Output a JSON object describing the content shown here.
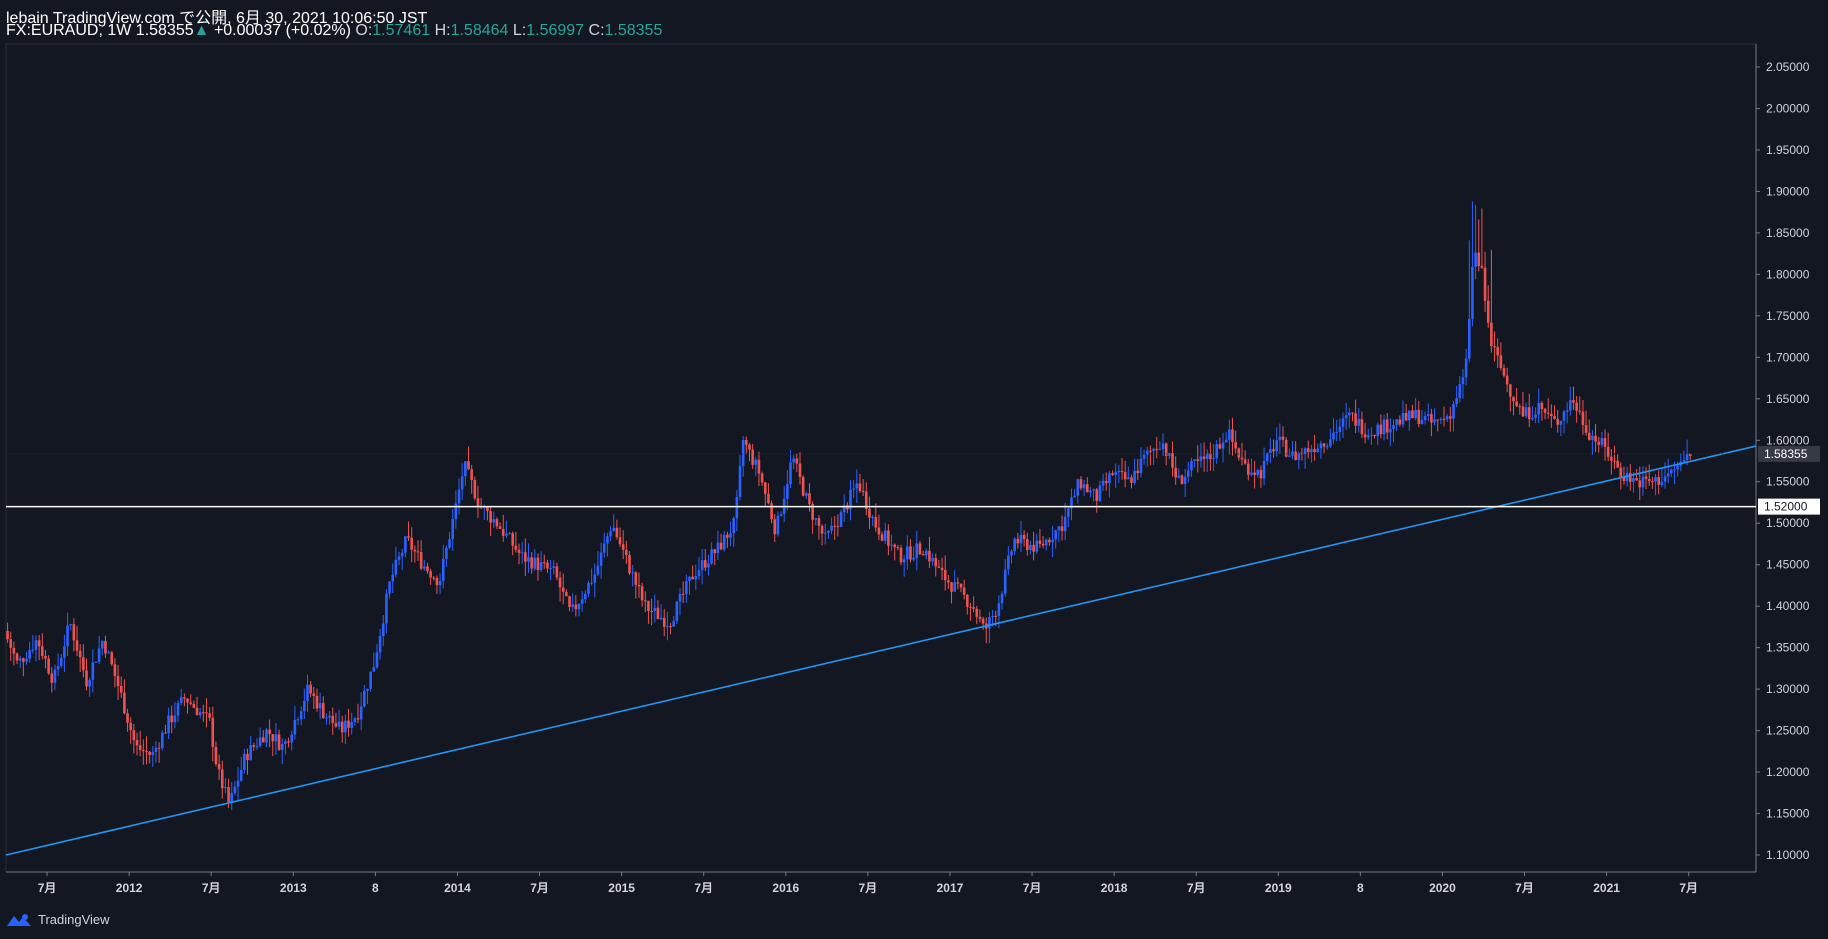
{
  "header": {
    "published": "lebain TradingView.com で公開, 6月 30, 2021 10:06:50 JST",
    "symbol": "FX:EURAUD, 1W",
    "last": "1.58355",
    "change_arrow": "▲",
    "change": "+0.00037 (+0.02%)",
    "o_label": "O:",
    "o_val": "1.57461",
    "h_label": "H:",
    "h_val": "1.58464",
    "l_label": "L:",
    "l_val": "1.56997",
    "c_label": "C:",
    "c_val": "1.58355"
  },
  "brand": {
    "label": "TradingView",
    "icon": "tradingview-logo-icon"
  },
  "colors": {
    "background": "#131722",
    "up": "#2962ff",
    "down": "#ef5350",
    "trendline": "#2196f3",
    "hline": "#ffffff",
    "axis": "#787b86",
    "text": "#d1d4dc",
    "value": "#26a69a"
  },
  "chart_data": {
    "type": "candlestick",
    "ylim": [
      1.08,
      2.08
    ],
    "y_ticks": [
      2.05,
      2.0,
      1.95,
      1.9,
      1.85,
      1.8,
      1.75,
      1.7,
      1.65,
      1.6,
      1.55,
      1.5,
      1.45,
      1.4,
      1.35,
      1.3,
      1.25,
      1.2,
      1.15,
      1.1
    ],
    "y_tick_labels": [
      "2.05000",
      "2.00000",
      "1.95000",
      "1.90000",
      "1.85000",
      "1.80000",
      "1.75000",
      "1.70000",
      "1.65000",
      "1.60000",
      "1.55000",
      "1.50000",
      "1.45000",
      "1.40000",
      "1.35000",
      "1.30000",
      "1.25000",
      "1.20000",
      "1.15000",
      "1.10000"
    ],
    "x_start": 2011.25,
    "x_end": 2021.91,
    "x_ticks": [
      {
        "label": "7月",
        "t": 2011.5
      },
      {
        "label": "2012",
        "t": 2012.0
      },
      {
        "label": "7月",
        "t": 2012.5
      },
      {
        "label": "2013",
        "t": 2013.0
      },
      {
        "label": "8",
        "t": 2013.5
      },
      {
        "label": "2014",
        "t": 2014.0
      },
      {
        "label": "7月",
        "t": 2014.5
      },
      {
        "label": "2015",
        "t": 2015.0
      },
      {
        "label": "7月",
        "t": 2015.5
      },
      {
        "label": "2016",
        "t": 2016.0
      },
      {
        "label": "7月",
        "t": 2016.5
      },
      {
        "label": "2017",
        "t": 2017.0
      },
      {
        "label": "7月",
        "t": 2017.5
      },
      {
        "label": "2018",
        "t": 2018.0
      },
      {
        "label": "7月",
        "t": 2018.5
      },
      {
        "label": "2019",
        "t": 2019.0
      },
      {
        "label": "8",
        "t": 2019.5
      },
      {
        "label": "2020",
        "t": 2020.0
      },
      {
        "label": "7月",
        "t": 2020.5
      },
      {
        "label": "2021",
        "t": 2021.0
      },
      {
        "label": "7月",
        "t": 2021.5
      }
    ],
    "path_anchors": [
      [
        2011.25,
        1.37
      ],
      [
        2011.33,
        1.33
      ],
      [
        2011.45,
        1.36
      ],
      [
        2011.55,
        1.31
      ],
      [
        2011.65,
        1.38
      ],
      [
        2011.75,
        1.31
      ],
      [
        2011.85,
        1.36
      ],
      [
        2011.95,
        1.3
      ],
      [
        2012.05,
        1.23
      ],
      [
        2012.15,
        1.22
      ],
      [
        2012.25,
        1.26
      ],
      [
        2012.35,
        1.29
      ],
      [
        2012.5,
        1.26
      ],
      [
        2012.55,
        1.2
      ],
      [
        2012.62,
        1.16
      ],
      [
        2012.72,
        1.22
      ],
      [
        2012.85,
        1.25
      ],
      [
        2012.95,
        1.23
      ],
      [
        2013.1,
        1.3
      ],
      [
        2013.2,
        1.27
      ],
      [
        2013.3,
        1.25
      ],
      [
        2013.4,
        1.27
      ],
      [
        2013.5,
        1.33
      ],
      [
        2013.6,
        1.43
      ],
      [
        2013.7,
        1.48
      ],
      [
        2013.8,
        1.45
      ],
      [
        2013.9,
        1.43
      ],
      [
        2014.0,
        1.52
      ],
      [
        2014.05,
        1.57
      ],
      [
        2014.15,
        1.52
      ],
      [
        2014.25,
        1.5
      ],
      [
        2014.4,
        1.46
      ],
      [
        2014.6,
        1.44
      ],
      [
        2014.7,
        1.39
      ],
      [
        2014.85,
        1.44
      ],
      [
        2014.95,
        1.5
      ],
      [
        2015.05,
        1.45
      ],
      [
        2015.15,
        1.4
      ],
      [
        2015.3,
        1.38
      ],
      [
        2015.45,
        1.44
      ],
      [
        2015.6,
        1.47
      ],
      [
        2015.7,
        1.5
      ],
      [
        2015.75,
        1.6
      ],
      [
        2015.85,
        1.56
      ],
      [
        2015.95,
        1.49
      ],
      [
        2016.05,
        1.58
      ],
      [
        2016.15,
        1.52
      ],
      [
        2016.25,
        1.48
      ],
      [
        2016.35,
        1.51
      ],
      [
        2016.45,
        1.55
      ],
      [
        2016.55,
        1.5
      ],
      [
        2016.7,
        1.46
      ],
      [
        2016.85,
        1.47
      ],
      [
        2016.95,
        1.44
      ],
      [
        2017.05,
        1.42
      ],
      [
        2017.15,
        1.4
      ],
      [
        2017.22,
        1.37
      ],
      [
        2017.3,
        1.4
      ],
      [
        2017.4,
        1.48
      ],
      [
        2017.55,
        1.47
      ],
      [
        2017.7,
        1.5
      ],
      [
        2017.8,
        1.55
      ],
      [
        2017.9,
        1.53
      ],
      [
        2018.0,
        1.56
      ],
      [
        2018.1,
        1.55
      ],
      [
        2018.2,
        1.58
      ],
      [
        2018.3,
        1.6
      ],
      [
        2018.4,
        1.55
      ],
      [
        2018.5,
        1.57
      ],
      [
        2018.6,
        1.58
      ],
      [
        2018.7,
        1.61
      ],
      [
        2018.8,
        1.57
      ],
      [
        2018.9,
        1.56
      ],
      [
        2019.0,
        1.6
      ],
      [
        2019.1,
        1.58
      ],
      [
        2019.2,
        1.59
      ],
      [
        2019.3,
        1.6
      ],
      [
        2019.45,
        1.63
      ],
      [
        2019.55,
        1.61
      ],
      [
        2019.7,
        1.62
      ],
      [
        2019.85,
        1.63
      ],
      [
        2019.95,
        1.62
      ],
      [
        2020.05,
        1.63
      ],
      [
        2020.15,
        1.68
      ],
      [
        2020.2,
        1.83
      ],
      [
        2020.25,
        1.8
      ],
      [
        2020.3,
        1.72
      ],
      [
        2020.4,
        1.67
      ],
      [
        2020.5,
        1.63
      ],
      [
        2020.6,
        1.64
      ],
      [
        2020.7,
        1.62
      ],
      [
        2020.8,
        1.65
      ],
      [
        2020.9,
        1.61
      ],
      [
        2021.0,
        1.59
      ],
      [
        2021.1,
        1.56
      ],
      [
        2021.2,
        1.55
      ],
      [
        2021.3,
        1.55
      ],
      [
        2021.4,
        1.56
      ],
      [
        2021.5,
        1.58
      ]
    ],
    "trendline": {
      "from": [
        2011.25,
        1.1
      ],
      "to": [
        2021.91,
        1.593
      ]
    },
    "horizontal_line": {
      "price": 1.52,
      "label": "1.52000"
    },
    "last_price": {
      "price": 1.58355,
      "label": "1.58355"
    }
  }
}
